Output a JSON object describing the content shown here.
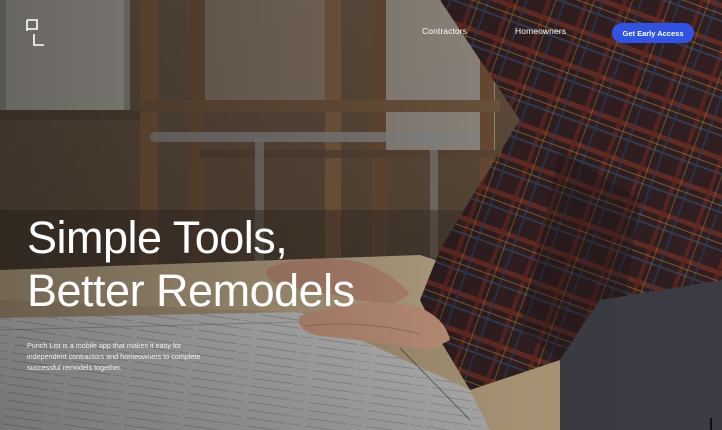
{
  "header": {
    "logo_text": "PL",
    "nav": {
      "contractors": "Contractors",
      "homeowners": "Homeowners"
    },
    "cta_label": "Get Early Access"
  },
  "hero": {
    "headline_line1": "Simple Tools,",
    "headline_line2": "Better Remodels",
    "description": "Punch List is a mobile app that makes it easy for independent contractors and homeowners to complete successful remodels together.",
    "background_image": "contractor-reviewing-blueprints-photo"
  },
  "colors": {
    "accent": "#2f53e5",
    "text_light": "#ffffff"
  },
  "icons": {
    "logo": "punch-list-logo-icon"
  }
}
